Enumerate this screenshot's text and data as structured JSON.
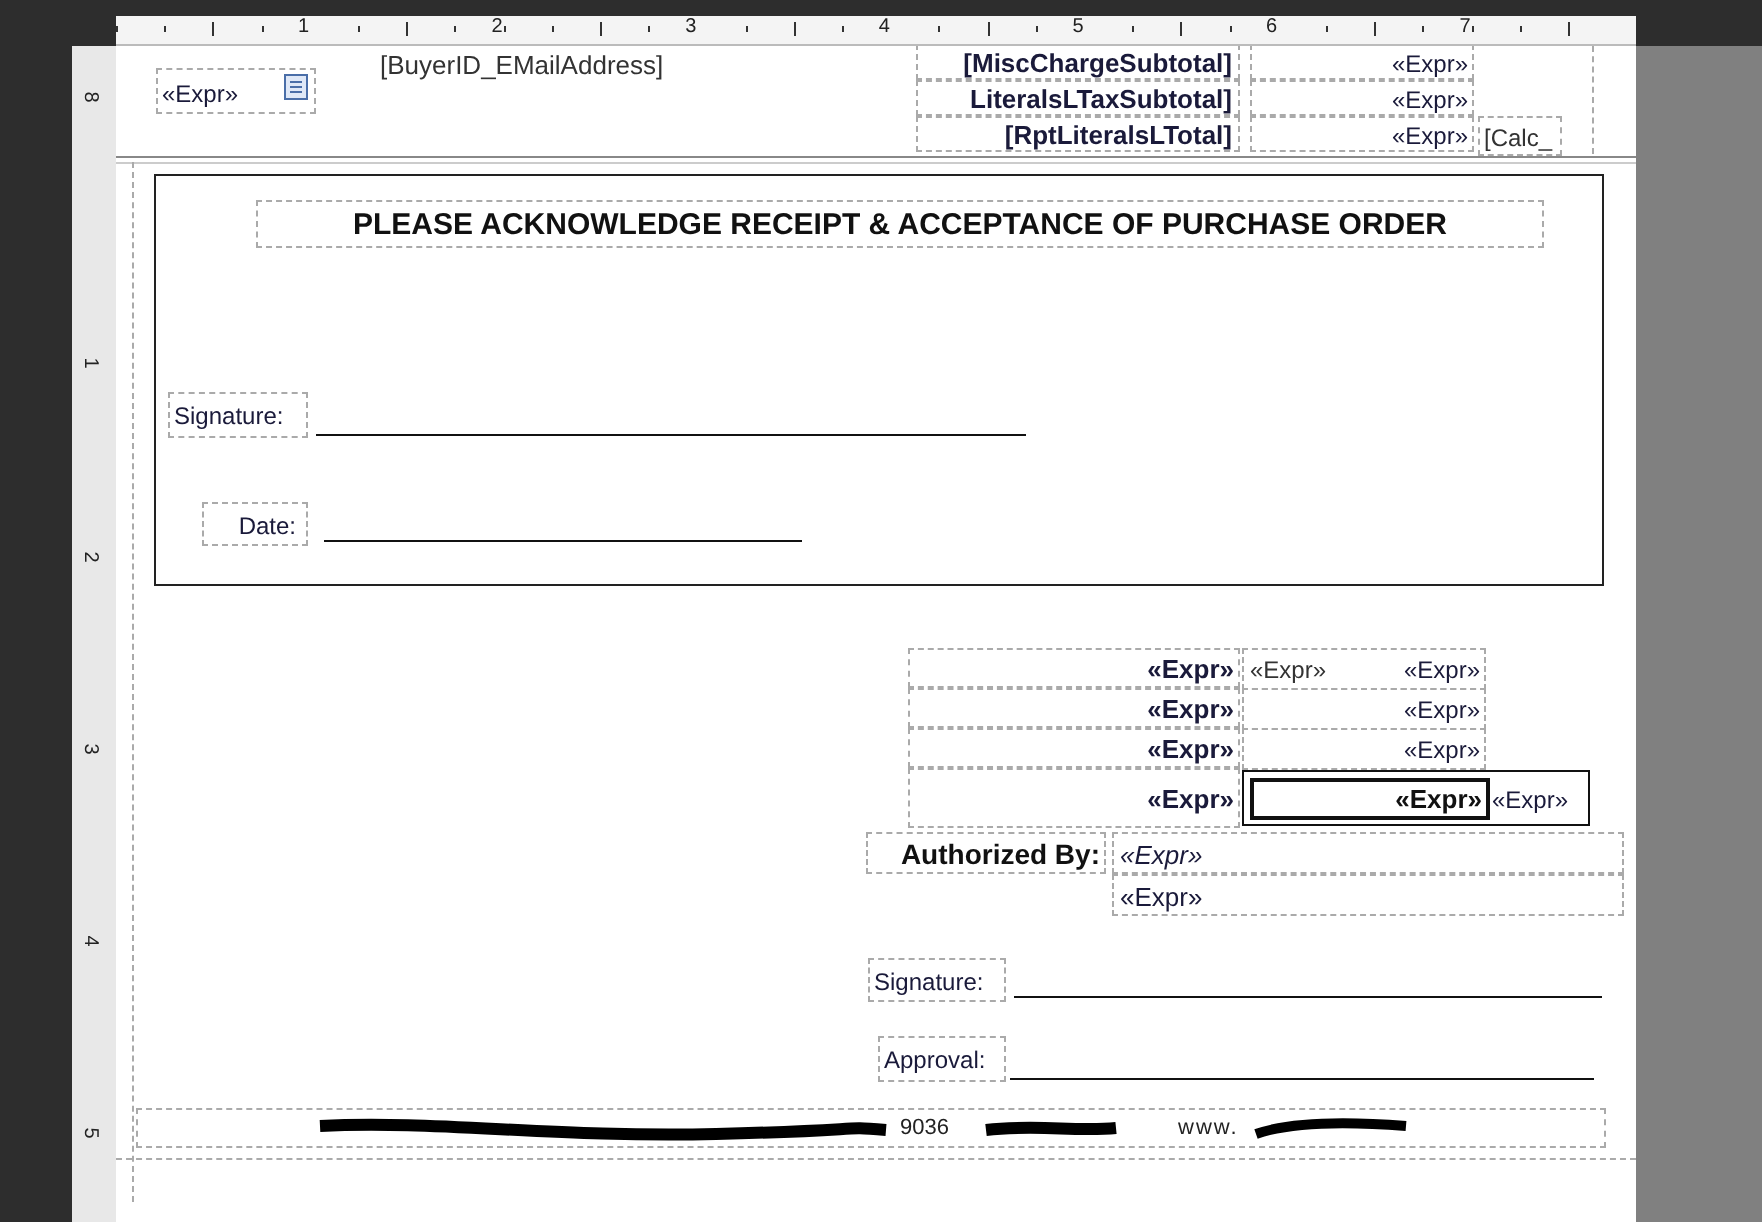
{
  "ruler": {
    "numbers": [
      "1",
      "2",
      "3",
      "4",
      "5",
      "6",
      "7"
    ]
  },
  "vertical_ruler": {
    "numbers": [
      "8",
      "1",
      "2",
      "3",
      "4",
      "5"
    ]
  },
  "header_band": {
    "expr_field": "«Expr»",
    "email_field": "[BuyerID_EMailAddress]",
    "labels": [
      "[MiscChargeSubtotal]",
      "LiteralsLTaxSubtotal]",
      "[RptLiteralsLTotal]"
    ],
    "values": [
      "«Expr»",
      "«Expr»",
      "«Expr»"
    ],
    "calc_field": "[Calc_"
  },
  "acknowledgement": {
    "title": "PLEASE ACKNOWLEDGE RECEIPT & ACCEPTANCE OF PURCHASE ORDER",
    "signature_label": "Signature:",
    "date_label": "Date:"
  },
  "totals": [
    {
      "label": "«Expr»",
      "values": [
        "«Expr»",
        "«Expr»"
      ]
    },
    {
      "label": "«Expr»",
      "values": [
        "«Expr»"
      ]
    },
    {
      "label": "«Expr»",
      "values": [
        "«Expr»"
      ]
    },
    {
      "label": "«Expr»",
      "values": [
        "«Expr»",
        "«Expr»"
      ]
    }
  ],
  "authorized": {
    "label": "Authorized By:",
    "name": "«Expr»",
    "title": "«Expr»"
  },
  "signature_label": "Signature:",
  "approval_label": "Approval:",
  "footer": {
    "parts": [
      "9036",
      "www."
    ]
  }
}
